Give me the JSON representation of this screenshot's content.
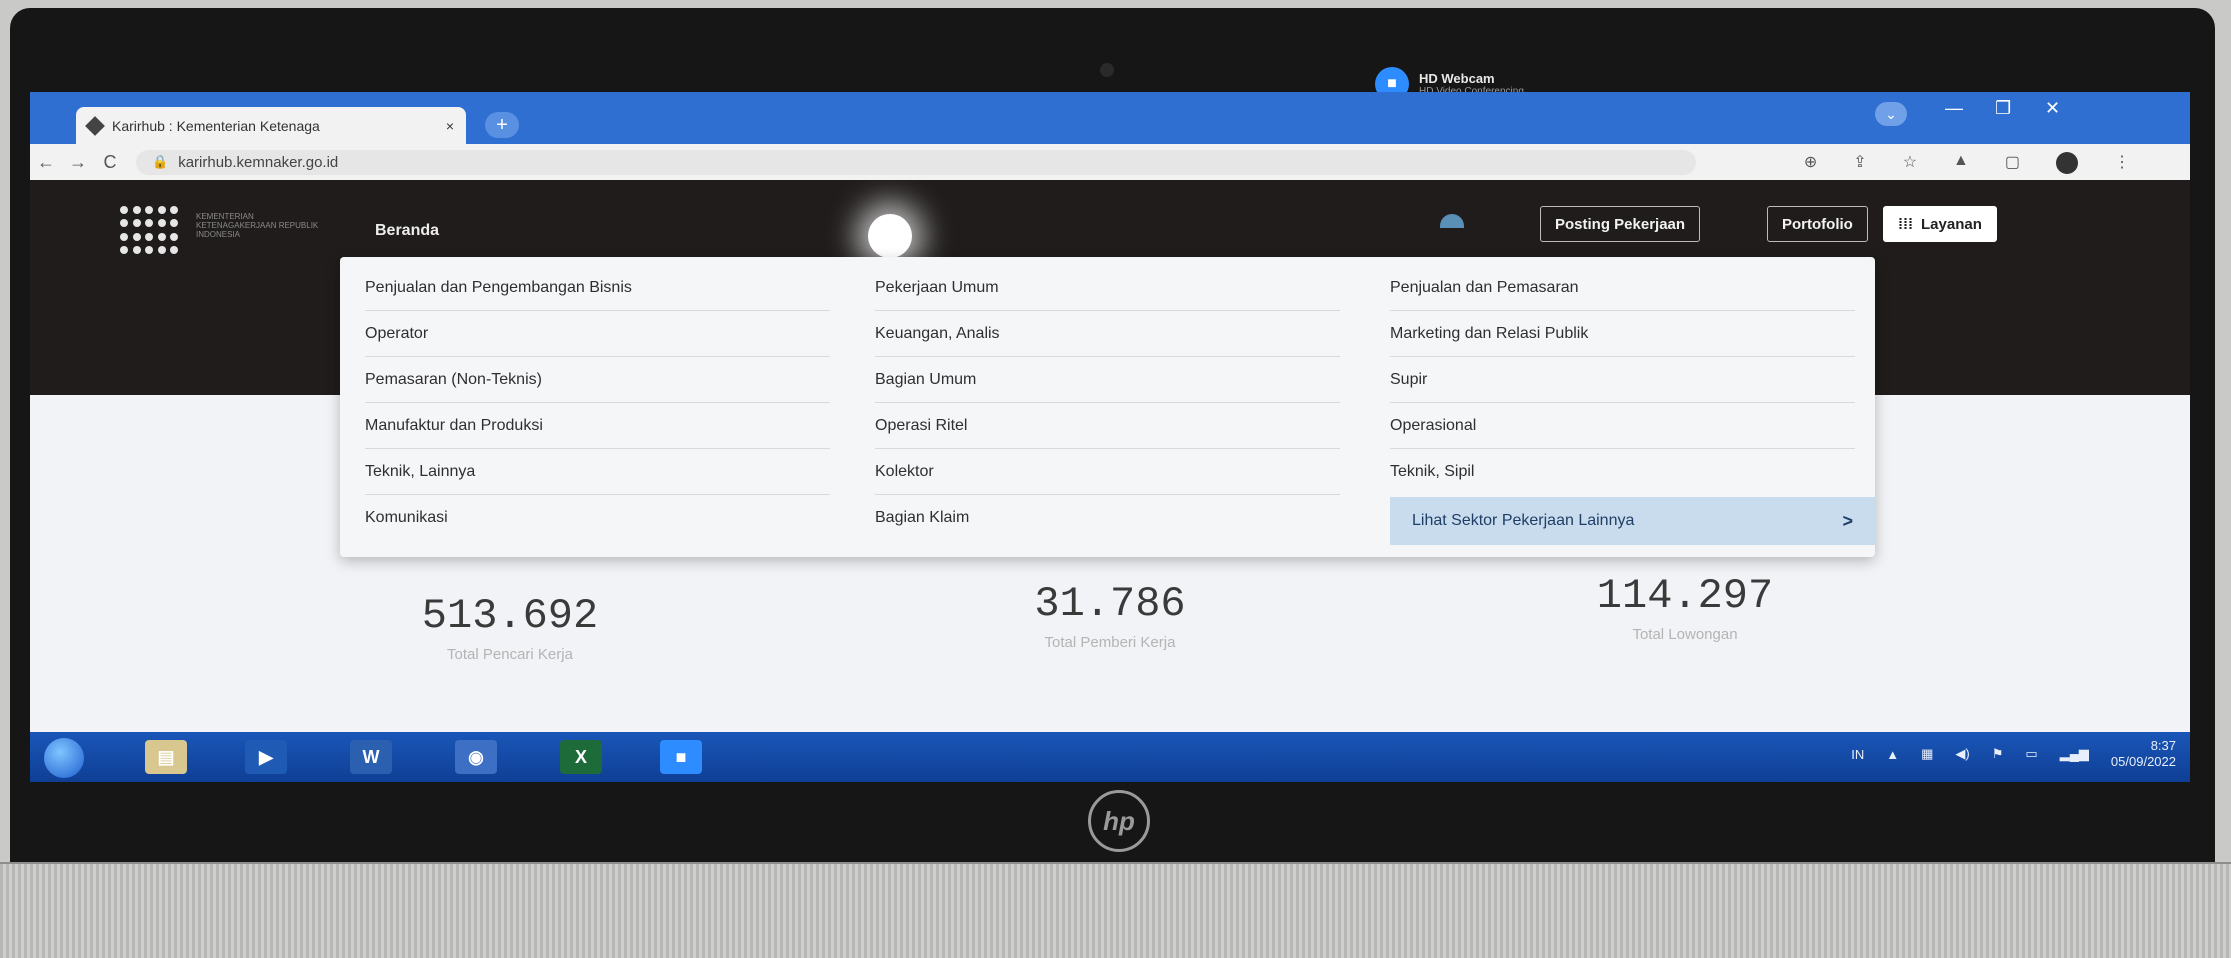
{
  "webcam_notification": {
    "title": "HD Webcam",
    "subtitle": "HD Video Conferencing"
  },
  "browser": {
    "tab_title": "Karirhub : Kementerian Ketenaga",
    "tab_close": "×",
    "new_tab": "+",
    "url": "karirhub.kemnaker.go.id",
    "back": "←",
    "forward": "→",
    "reload": "C"
  },
  "site": {
    "logo_text": "KEMENTERIAN KETENAGAKERJAAN REPUBLIK INDONESIA",
    "nav_home": "Beranda",
    "btn_posting": "Posting Pekerjaan",
    "btn_portfolio": "Portofolio",
    "btn_services": "Layanan"
  },
  "menu": {
    "col1": [
      "Penjualan dan Pengembangan Bisnis",
      "Operator",
      "Pemasaran (Non-Teknis)",
      "Manufaktur dan Produksi",
      "Teknik, Lainnya",
      "Komunikasi"
    ],
    "col2": [
      "Pekerjaan Umum",
      "Keuangan, Analis",
      "Bagian Umum",
      "Operasi Ritel",
      "Kolektor",
      "Bagian Klaim"
    ],
    "col3": [
      "Penjualan dan Pemasaran",
      "Marketing dan Relasi Publik",
      "Supir",
      "Operasional",
      "Teknik, Sipil"
    ],
    "cta": "Lihat Sektor Pekerjaan Lainnya",
    "cta_arrow": ">"
  },
  "stats": [
    {
      "value": "513.692",
      "label": "Total Pencari Kerja"
    },
    {
      "value": "31.786",
      "label": "Total Pemberi Kerja"
    },
    {
      "value": "114.297",
      "label": "Total Lowongan"
    }
  ],
  "taskbar": {
    "apps": [
      "explorer",
      "media-player",
      "word",
      "chrome",
      "excel",
      "zoom"
    ],
    "lang": "IN",
    "time": "8:37",
    "date": "05/09/2022"
  },
  "brand": "hp"
}
